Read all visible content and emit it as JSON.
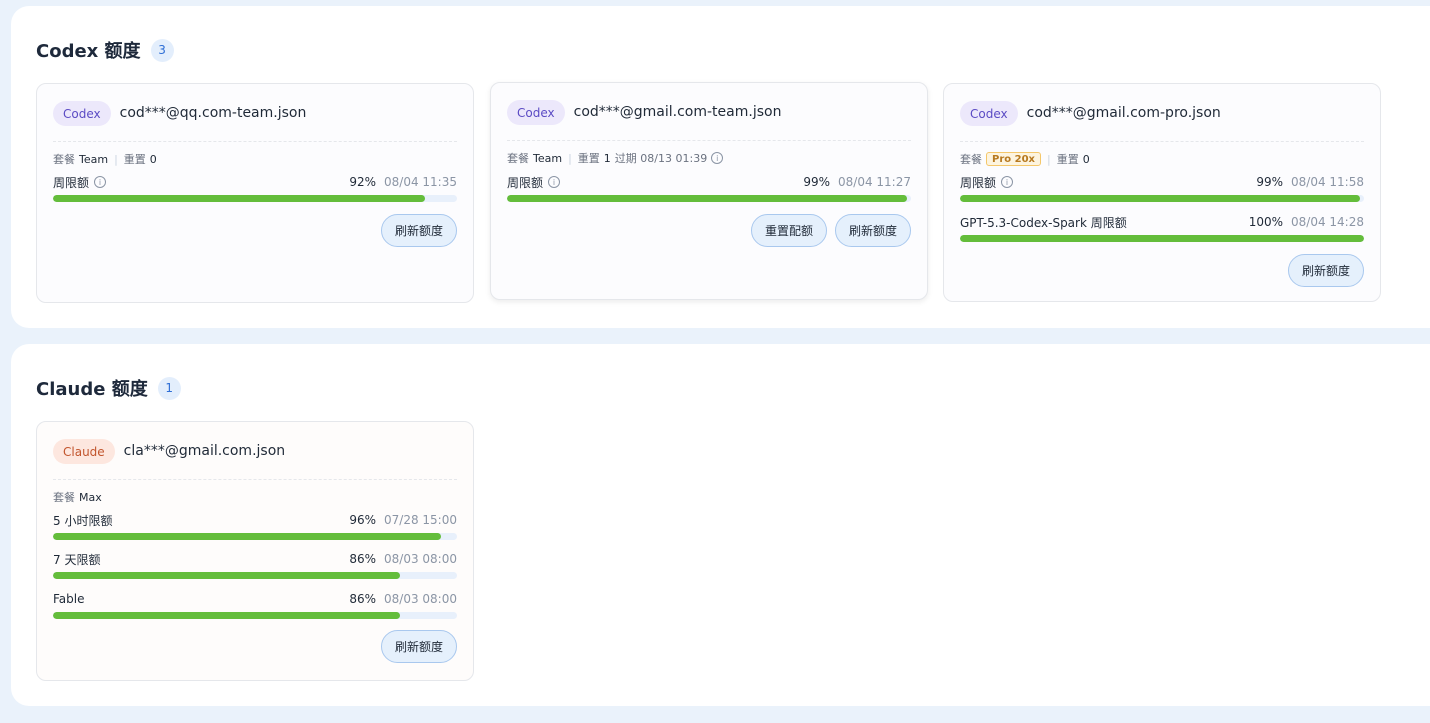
{
  "codex": {
    "title": "Codex 额度",
    "count": "3",
    "cards": [
      {
        "tag": "Codex",
        "file": "cod***@qq.com-team.json",
        "plan_label": "套餐",
        "plan_value": "Team",
        "reset_label": "重置",
        "reset_value": "0",
        "quotas": [
          {
            "label": "周限额",
            "pct_text": "92%",
            "fill": 0.92,
            "time": "08/04 11:35"
          }
        ],
        "buttons": [
          "刷新额度"
        ]
      },
      {
        "tag": "Codex",
        "file": "cod***@gmail.com-team.json",
        "plan_label": "套餐",
        "plan_value": "Team",
        "reset_label": "重置",
        "reset_value": "1",
        "expire_text": "过期 08/13 01:39",
        "quotas": [
          {
            "label": "周限额",
            "pct_text": "99%",
            "fill": 0.99,
            "time": "08/04 11:27"
          }
        ],
        "buttons": [
          "重置配额",
          "刷新额度"
        ]
      },
      {
        "tag": "Codex",
        "file": "cod***@gmail.com-pro.json",
        "plan_label": "套餐",
        "plan_value": "Pro 20x",
        "reset_label": "重置",
        "reset_value": "0",
        "quotas": [
          {
            "label": "周限额",
            "pct_text": "99%",
            "fill": 0.99,
            "time": "08/04 11:58"
          },
          {
            "label": "GPT-5.3-Codex-Spark 周限额",
            "pct_text": "100%",
            "fill": 1.0,
            "time": "08/04 14:28"
          }
        ],
        "buttons": [
          "刷新额度"
        ]
      }
    ]
  },
  "claude": {
    "title": "Claude 额度",
    "count": "1",
    "cards": [
      {
        "tag": "Claude",
        "file": "cla***@gmail.com.json",
        "plan_label": "套餐",
        "plan_value": "Max",
        "quotas": [
          {
            "label": "5 小时限额",
            "pct_text": "96%",
            "fill": 0.96,
            "time": "07/28 15:00"
          },
          {
            "label": "7 天限额",
            "pct_text": "86%",
            "fill": 0.86,
            "time": "08/03 08:00"
          },
          {
            "label": "Fable",
            "pct_text": "86%",
            "fill": 0.86,
            "time": "08/03 08:00"
          }
        ],
        "buttons": [
          "刷新额度"
        ]
      }
    ]
  },
  "colors": {
    "bar_fill": "#64bd3b",
    "bar_track": "#e8f0fb",
    "codex_tag": "#5b4bc4",
    "claude_tag": "#c2552d"
  }
}
